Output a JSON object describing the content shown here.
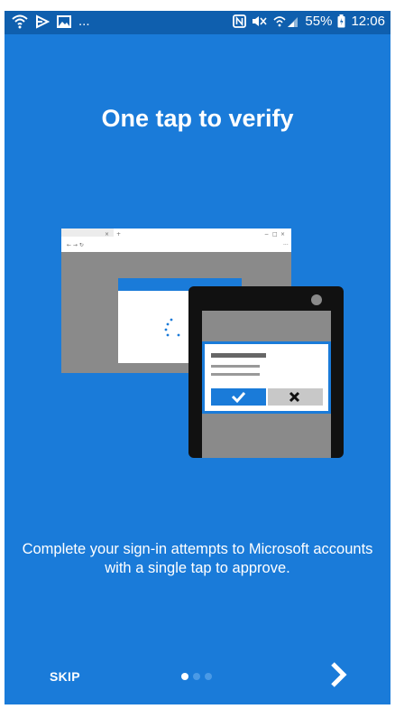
{
  "statusbar": {
    "battery": "55%",
    "time": "12:06",
    "more": "..."
  },
  "onboarding": {
    "title": "One tap to verify",
    "description": "Complete your sign-in attempts to Microsoft accounts with a single tap to approve.",
    "skip_label": "SKIP",
    "page_count": 3,
    "current_page": 1
  },
  "colors": {
    "background": "#1a7bd9",
    "statusbar": "#0f5fae",
    "accent": "#1a7bd9"
  },
  "icons": [
    "wifi-icon",
    "cast-icon",
    "gallery-icon",
    "nfc-icon",
    "mute-icon",
    "signal-icon",
    "battery-icon",
    "chevron-right-icon",
    "checkmark-icon",
    "close-icon"
  ]
}
